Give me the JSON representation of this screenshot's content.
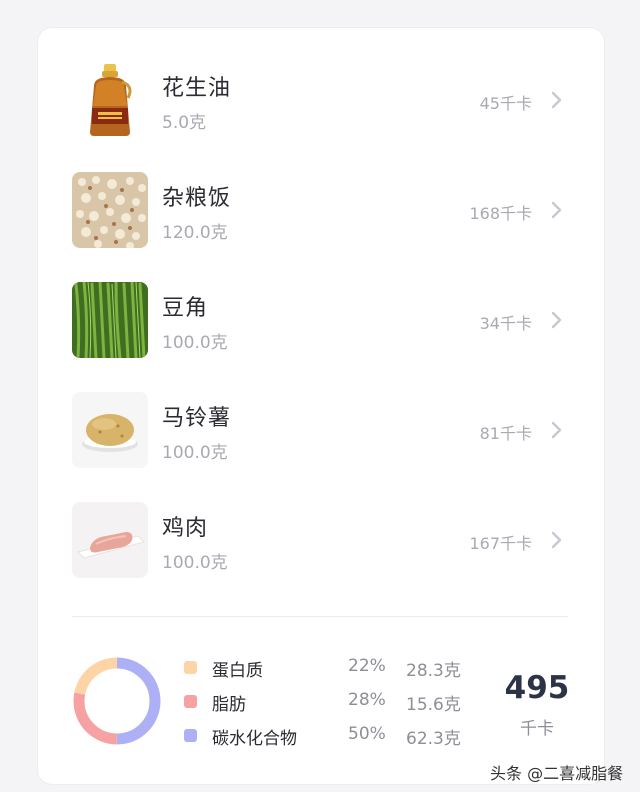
{
  "foods": [
    {
      "name": "花生油",
      "amount": "5.0克",
      "kcal": "45千卡",
      "icon": "oil-bottle-icon"
    },
    {
      "name": "杂粮饭",
      "amount": "120.0克",
      "kcal": "168千卡",
      "icon": "mixed-grain-rice-icon"
    },
    {
      "name": "豆角",
      "amount": "100.0克",
      "kcal": "34千卡",
      "icon": "green-beans-icon"
    },
    {
      "name": "马铃薯",
      "amount": "100.0克",
      "kcal": "81千卡",
      "icon": "potato-icon"
    },
    {
      "name": "鸡肉",
      "amount": "100.0克",
      "kcal": "167千卡",
      "icon": "chicken-icon"
    }
  ],
  "summary": {
    "nutrients": [
      {
        "name": "蛋白质",
        "percent": "22%",
        "grams": "28.3克",
        "color": "#fdd4a6",
        "share": 0.22
      },
      {
        "name": "脂肪",
        "percent": "28%",
        "grams": "15.6克",
        "color": "#f6a2a2",
        "share": 0.28
      },
      {
        "name": "碳水化合物",
        "percent": "50%",
        "grams": "62.3克",
        "color": "#aeb0f6",
        "share": 0.5
      }
    ],
    "total_kcal": "495",
    "total_unit": "千卡"
  },
  "watermark": "头条 @二喜减脂餐"
}
